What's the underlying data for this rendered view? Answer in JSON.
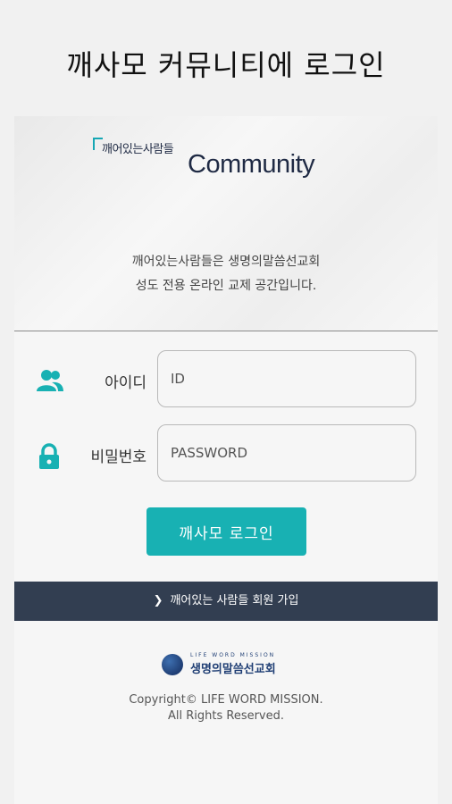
{
  "page": {
    "title": "깨사모 커뮤니티에 로그인"
  },
  "logo": {
    "small_text": "깨어있는사람들",
    "big_text": "Community"
  },
  "intro": {
    "line1": "깨어있는사람들은 생명의말씀선교회",
    "line2": "성도 전용 온라인 교제 공간입니다."
  },
  "form": {
    "id_label": "아이디",
    "id_placeholder": "ID",
    "password_label": "비밀번호",
    "password_placeholder": "PASSWORD",
    "login_label": "깨사모 로그인"
  },
  "signup": {
    "label": "깨어있는 사람들 회원 가입"
  },
  "footer": {
    "mission_en": "LIFE WORD MISSION",
    "mission_ko": "생명의말씀선교회",
    "copyright_line1": "Copyright© LIFE WORD MISSION.",
    "copyright_line2": "All Rights Reserved."
  },
  "colors": {
    "accent": "#18b1b3",
    "bar": "#323e51",
    "brand_navy": "#1f2a44"
  },
  "icons": {
    "user": "users-icon",
    "lock": "lock-icon",
    "chevron": "chevron-right-icon"
  }
}
